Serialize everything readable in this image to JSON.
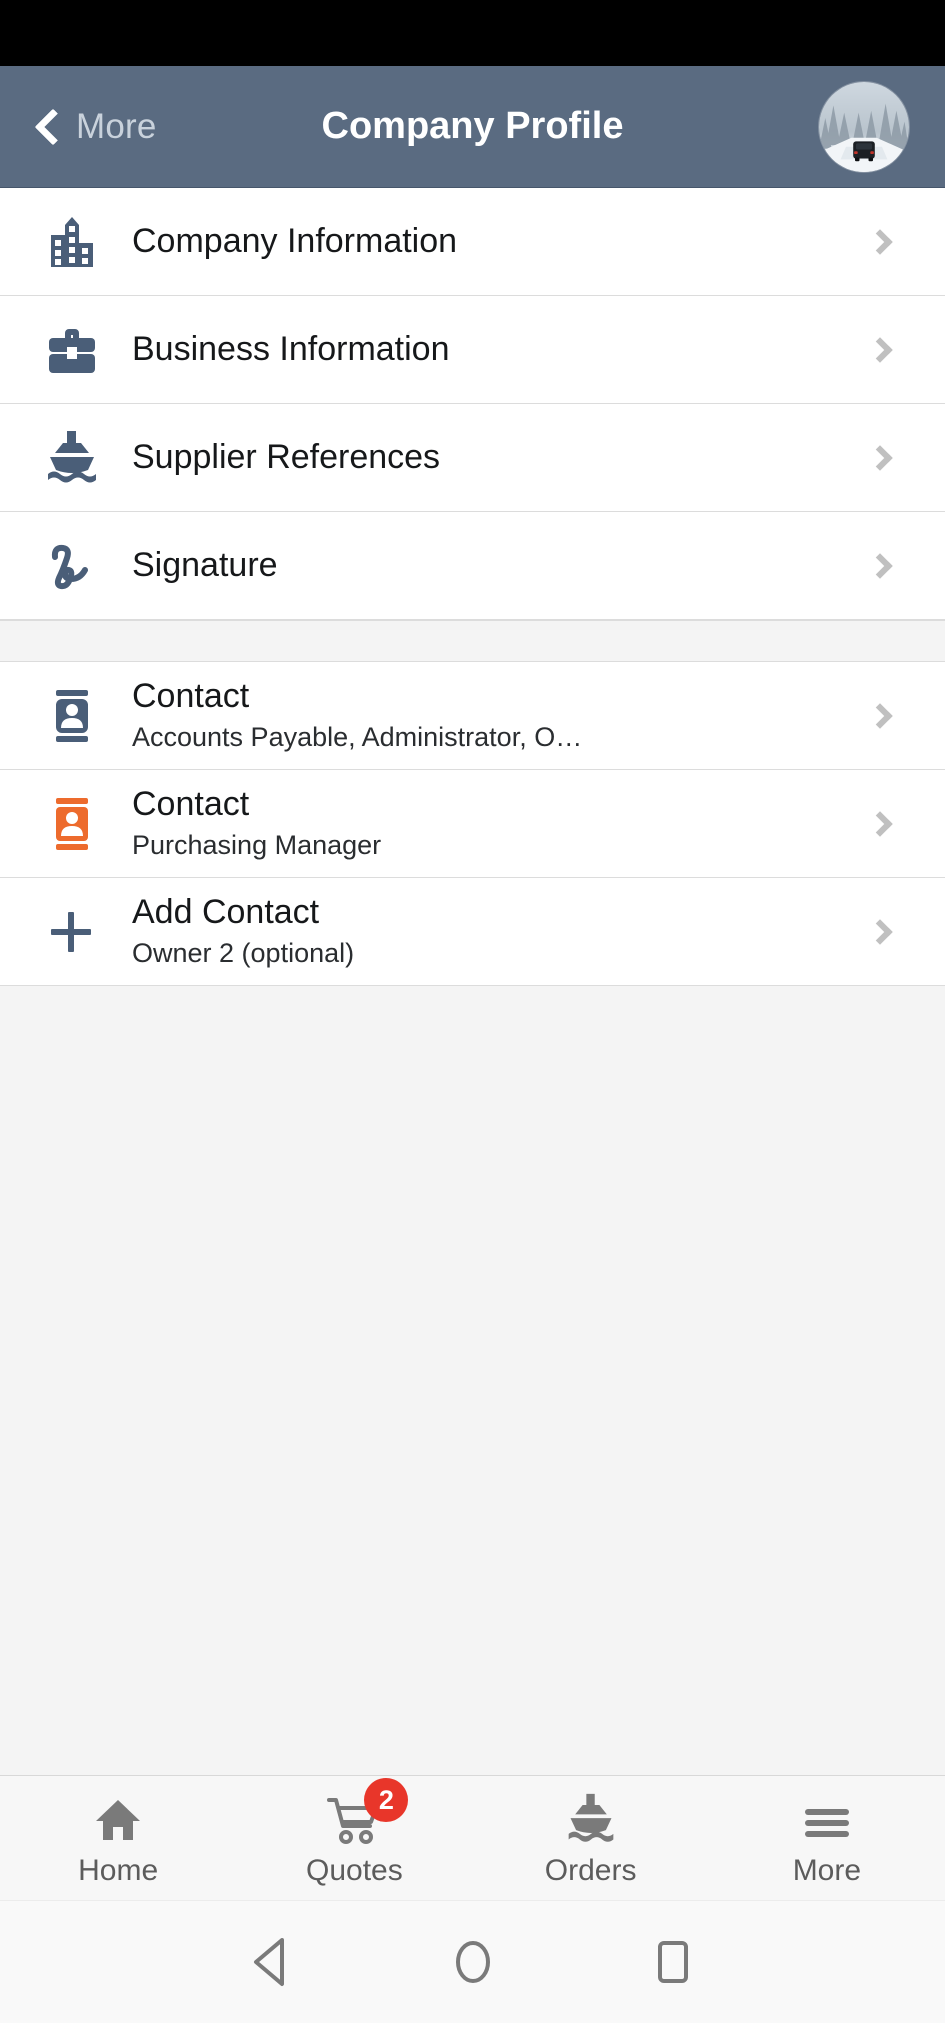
{
  "header": {
    "back_label": "More",
    "back_icon": "chevron-left-icon",
    "title": "Company Profile",
    "avatar_icon": "user-avatar-photo",
    "background_color": "#5a6b81",
    "title_color": "#ffffff"
  },
  "sections": [
    {
      "id": "profile-sections",
      "rows": [
        {
          "title": "Company Information",
          "subtitle": "",
          "icon": "building-icon",
          "icon_color": "#4a5e78",
          "chevron": "chevron-right-icon"
        },
        {
          "title": "Business Information",
          "subtitle": "",
          "icon": "briefcase-icon",
          "icon_color": "#4a5e78",
          "chevron": "chevron-right-icon"
        },
        {
          "title": "Supplier References",
          "subtitle": "",
          "icon": "ship-icon",
          "icon_color": "#4a5e78",
          "chevron": "chevron-right-icon"
        },
        {
          "title": "Signature",
          "subtitle": "",
          "icon": "signature-icon",
          "icon_color": "#4a5e78",
          "chevron": "chevron-right-icon"
        }
      ]
    },
    {
      "id": "contacts-section",
      "rows": [
        {
          "title": "Contact",
          "subtitle": "Accounts Payable, Administrator, O…",
          "icon": "contact-card-icon",
          "icon_color": "#4a5e78",
          "chevron": "chevron-right-icon"
        },
        {
          "title": "Contact",
          "subtitle": "Purchasing Manager",
          "icon": "contact-card-icon",
          "icon_color": "#ed6b2d",
          "chevron": "chevron-right-icon"
        },
        {
          "title": "Add Contact",
          "subtitle": "Owner 2 (optional)",
          "icon": "plus-icon",
          "icon_color": "#4a5e78",
          "chevron": "chevron-right-icon"
        }
      ]
    }
  ],
  "tabbar": {
    "items": [
      {
        "label": "Home",
        "icon": "home-icon",
        "badge": ""
      },
      {
        "label": "Quotes",
        "icon": "cart-icon",
        "badge": "2"
      },
      {
        "label": "Orders",
        "icon": "ship-icon",
        "badge": ""
      },
      {
        "label": "More",
        "icon": "hamburger-icon",
        "badge": ""
      }
    ],
    "badge_color": "#e8362a",
    "icon_color": "#7a7a7a"
  },
  "android_nav": {
    "back": "android-back-icon",
    "home": "android-home-icon",
    "recents": "android-recents-icon"
  },
  "colors": {
    "page_background": "#f4f4f4",
    "row_background": "#ffffff",
    "divider": "#dcdcdc",
    "accent_orange": "#ed6b2d",
    "accent_slate": "#4a5e78"
  }
}
